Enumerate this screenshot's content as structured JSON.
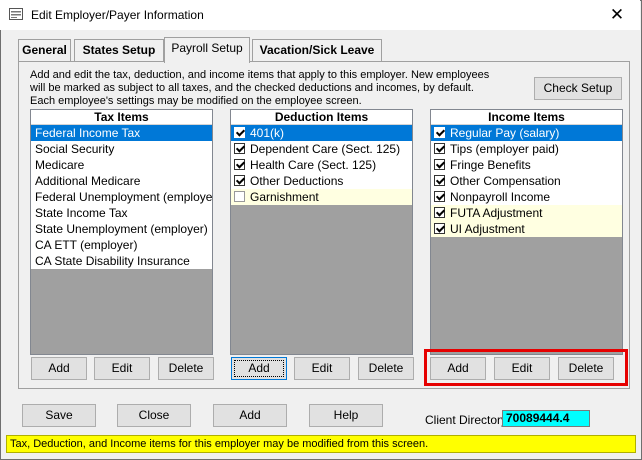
{
  "window": {
    "title": "Edit Employer/Payer Information",
    "close_glyph": "✕"
  },
  "tabs": [
    {
      "label": "General",
      "active": false
    },
    {
      "label": "States Setup",
      "active": false
    },
    {
      "label": "Payroll Setup",
      "active": true
    },
    {
      "label": "Vacation/Sick Leave",
      "active": false
    }
  ],
  "description": {
    "line1": "Add and edit the tax, deduction, and income items that apply to this employer.  New employees",
    "line2": "will be marked as subject to all taxes, and the checked deductions and incomes, by default.",
    "line3": "Each employee's settings may be modified on the employee screen."
  },
  "check_setup_label": "Check Setup",
  "tax_list": {
    "header": "Tax Items",
    "items": [
      "Federal Income Tax",
      "Social Security",
      "Medicare",
      "Additional Medicare",
      "Federal Unemployment (employer)",
      "State Income Tax",
      "State Unemployment (employer)",
      "CA ETT (employer)",
      "CA State Disability Insurance"
    ],
    "add": "Add",
    "edit": "Edit",
    "delete": "Delete"
  },
  "deduction_list": {
    "header": "Deduction Items",
    "items": [
      {
        "label": "401(k)",
        "checked": true
      },
      {
        "label": "Dependent Care (Sect. 125)",
        "checked": true
      },
      {
        "label": "Health Care (Sect. 125)",
        "checked": true
      },
      {
        "label": "Other Deductions",
        "checked": true
      },
      {
        "label": "Garnishment",
        "checked": false
      }
    ],
    "add": "Add",
    "edit": "Edit",
    "delete": "Delete"
  },
  "income_list": {
    "header": "Income Items",
    "items": [
      {
        "label": "Regular Pay (salary)",
        "checked": true
      },
      {
        "label": "Tips (employer paid)",
        "checked": true
      },
      {
        "label": "Fringe Benefits",
        "checked": true
      },
      {
        "label": "Other Compensation",
        "checked": true
      },
      {
        "label": "Nonpayroll Income",
        "checked": true
      },
      {
        "label": "FUTA Adjustment",
        "checked": true
      },
      {
        "label": "UI Adjustment",
        "checked": true
      }
    ],
    "add": "Add",
    "edit": "Edit",
    "delete": "Delete"
  },
  "bottom": {
    "save": "Save",
    "close": "Close",
    "add": "Add",
    "help": "Help",
    "client_label": "Client Directory",
    "client_value": "70089444.4"
  },
  "status_text": "Tax, Deduction, and Income items for this employer may be modified from this screen.",
  "colors": {
    "selection": "#0078d7",
    "highlight_box": "#e60000",
    "status_bg": "#ffff00",
    "client_bg": "#00ffff"
  }
}
